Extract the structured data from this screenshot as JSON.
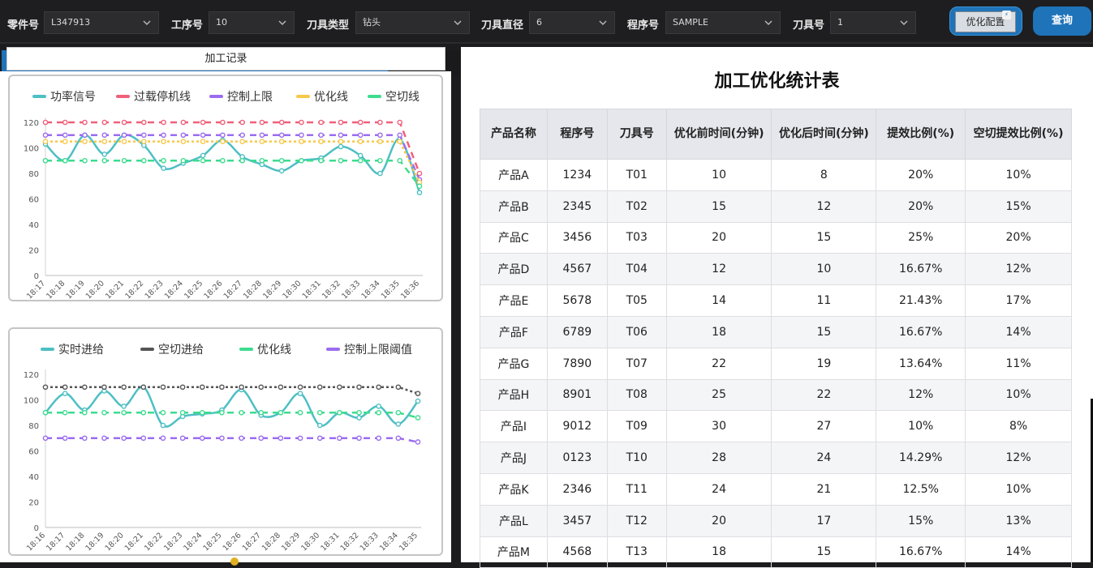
{
  "filters": [
    {
      "label": "零件号",
      "value": "L347913"
    },
    {
      "label": "工序号",
      "value": "10"
    },
    {
      "label": "刀具类型",
      "value": "钻头"
    },
    {
      "label": "刀具直径",
      "value": "6"
    },
    {
      "label": "程序号",
      "value": "SAMPLE"
    },
    {
      "label": "刀具号",
      "value": "1"
    }
  ],
  "buttons": {
    "optimize": "优化配置",
    "badge": "⚡",
    "query": "查询"
  },
  "left_tab": "加工记录",
  "chart_data": [
    {
      "type": "line",
      "legend_position": "top",
      "ylim": [
        0,
        120
      ],
      "yticks": [
        0,
        20,
        40,
        60,
        80,
        100,
        120
      ],
      "categories": [
        "18:17",
        "18:18",
        "18:19",
        "18:20",
        "18:21",
        "18:22",
        "18:23",
        "18:24",
        "18:25",
        "18:26",
        "18:27",
        "18:28",
        "18:29",
        "18:30",
        "18:31",
        "18:32",
        "18:33",
        "18:34",
        "18:35",
        "18:36"
      ],
      "series": [
        {
          "name": "功率信号",
          "color": "#4ebfc4",
          "values": [
            103,
            90,
            110,
            95,
            110,
            102,
            84,
            88,
            94,
            106,
            93,
            87,
            82,
            90,
            92,
            101,
            94,
            80,
            107,
            65
          ]
        },
        {
          "name": "过载停机线",
          "color": "#f0607a",
          "values": [
            120,
            120,
            120,
            120,
            120,
            120,
            120,
            120,
            120,
            120,
            120,
            120,
            120,
            120,
            120,
            120,
            120,
            120,
            120,
            80
          ]
        },
        {
          "name": "控制上限",
          "color": "#9b6cf0",
          "values": [
            110,
            110,
            110,
            110,
            110,
            110,
            110,
            110,
            110,
            110,
            110,
            110,
            110,
            110,
            110,
            110,
            110,
            110,
            110,
            75
          ]
        },
        {
          "name": "优化线",
          "color": "#f7c84a",
          "values": [
            105,
            105,
            105,
            105,
            105,
            105,
            105,
            105,
            105,
            105,
            105,
            105,
            105,
            105,
            105,
            105,
            105,
            105,
            105,
            73
          ]
        },
        {
          "name": "空切线",
          "color": "#3ddc8f",
          "values": [
            90,
            90,
            90,
            90,
            90,
            90,
            90,
            90,
            90,
            90,
            90,
            90,
            90,
            90,
            90,
            90,
            90,
            90,
            90,
            70
          ]
        }
      ]
    },
    {
      "type": "line",
      "legend_position": "top",
      "ylim": [
        0,
        120
      ],
      "yticks": [
        0,
        20,
        40,
        60,
        80,
        100,
        120
      ],
      "categories": [
        "18:16",
        "18:17",
        "18:18",
        "18:19",
        "18:20",
        "18:21",
        "18:22",
        "18:23",
        "18:24",
        "18:25",
        "18:26",
        "18:27",
        "18:28",
        "18:29",
        "18:30",
        "18:31",
        "18:32",
        "18:33",
        "18:34",
        "18:35"
      ],
      "series": [
        {
          "name": "实时进给",
          "color": "#4ebfc4",
          "values": [
            90,
            105,
            92,
            107,
            95,
            110,
            80,
            87,
            89,
            92,
            108,
            88,
            90,
            105,
            80,
            90,
            86,
            95,
            81,
            99
          ]
        },
        {
          "name": "空切进给",
          "color": "#555555",
          "values": [
            110,
            110,
            110,
            110,
            110,
            110,
            110,
            110,
            110,
            110,
            110,
            110,
            110,
            110,
            110,
            110,
            110,
            110,
            110,
            105
          ]
        },
        {
          "name": "优化线",
          "color": "#3ddc8f",
          "values": [
            90,
            90,
            90,
            90,
            90,
            90,
            90,
            90,
            90,
            90,
            90,
            90,
            90,
            90,
            90,
            90,
            90,
            90,
            90,
            86
          ]
        },
        {
          "name": "控制上限阈值",
          "color": "#9b6cf0",
          "values": [
            70,
            70,
            70,
            70,
            70,
            70,
            70,
            70,
            70,
            70,
            70,
            70,
            70,
            70,
            70,
            70,
            70,
            70,
            70,
            67
          ]
        }
      ]
    }
  ],
  "table": {
    "title": "加工优化统计表",
    "headers": [
      "产品名称",
      "程序号",
      "刀具号",
      "优化前时间(分钟)",
      "优化后时间(分钟)",
      "提效比例(%)",
      "空切提效比例(%)"
    ],
    "rows": [
      [
        "产品A",
        "1234",
        "T01",
        "10",
        "8",
        "20%",
        "10%"
      ],
      [
        "产品B",
        "2345",
        "T02",
        "15",
        "12",
        "20%",
        "15%"
      ],
      [
        "产品C",
        "3456",
        "T03",
        "20",
        "15",
        "25%",
        "20%"
      ],
      [
        "产品D",
        "4567",
        "T04",
        "12",
        "10",
        "16.67%",
        "12%"
      ],
      [
        "产品E",
        "5678",
        "T05",
        "14",
        "11",
        "21.43%",
        "17%"
      ],
      [
        "产品F",
        "6789",
        "T06",
        "18",
        "15",
        "16.67%",
        "14%"
      ],
      [
        "产品G",
        "7890",
        "T07",
        "22",
        "19",
        "13.64%",
        "11%"
      ],
      [
        "产品H",
        "8901",
        "T08",
        "25",
        "22",
        "12%",
        "10%"
      ],
      [
        "产品I",
        "9012",
        "T09",
        "30",
        "27",
        "10%",
        "8%"
      ],
      [
        "产品J",
        "0123",
        "T10",
        "28",
        "24",
        "14.29%",
        "12%"
      ],
      [
        "产品K",
        "2346",
        "T11",
        "24",
        "21",
        "12.5%",
        "10%"
      ],
      [
        "产品L",
        "3457",
        "T12",
        "20",
        "17",
        "15%",
        "13%"
      ],
      [
        "产品M",
        "4568",
        "T13",
        "18",
        "15",
        "16.67%",
        "14%"
      ]
    ]
  }
}
